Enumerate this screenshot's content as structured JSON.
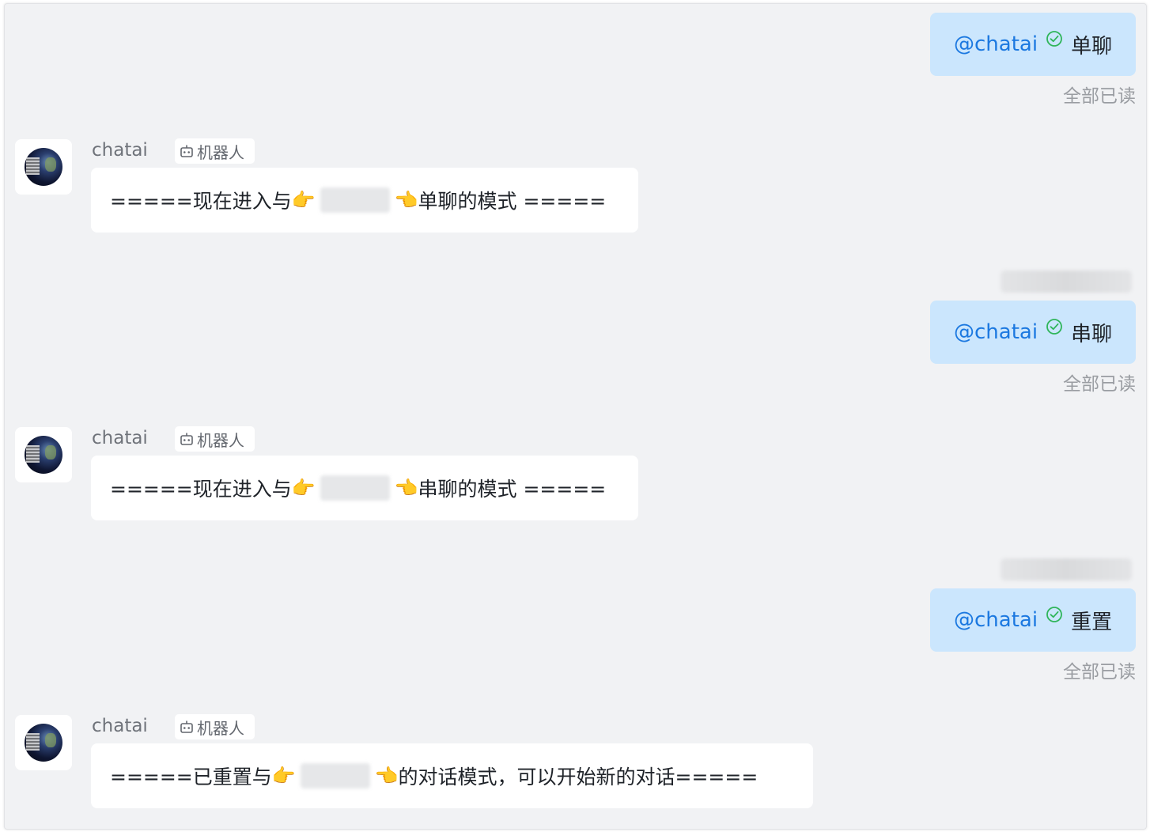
{
  "chat": {
    "messages": [
      {
        "direction": "outgoing",
        "mention": "@chatai",
        "command": "单聊",
        "read_status": "全部已读"
      },
      {
        "direction": "incoming",
        "sender": "chatai",
        "tag": "机器人",
        "text_before": "=====现在进入与",
        "pointer_right": "👉",
        "pointer_left": "👈",
        "text_after": "单聊的模式 ====="
      },
      {
        "direction": "outgoing",
        "mention": "@chatai",
        "command": "串聊",
        "read_status": "全部已读"
      },
      {
        "direction": "incoming",
        "sender": "chatai",
        "tag": "机器人",
        "text_before": "=====现在进入与",
        "pointer_right": "👉",
        "pointer_left": "👈",
        "text_after": "串聊的模式 ====="
      },
      {
        "direction": "outgoing",
        "mention": "@chatai",
        "command": "重置",
        "read_status": "全部已读"
      },
      {
        "direction": "incoming",
        "sender": "chatai",
        "tag": "机器人",
        "text_before": "=====已重置与",
        "pointer_right": "👉",
        "pointer_left": "👈",
        "text_after": "的对话模式，可以开始新的对话====="
      }
    ]
  },
  "icons": {
    "check": "check-circle-icon",
    "robot": "robot-icon",
    "avatar": "earth-globe-avatar"
  },
  "colors": {
    "background": "#f1f2f4",
    "outgoing_bubble": "#cbe6fd",
    "mention": "#1b78e0",
    "check": "#2fb55a",
    "read_status": "#9a9da2"
  }
}
